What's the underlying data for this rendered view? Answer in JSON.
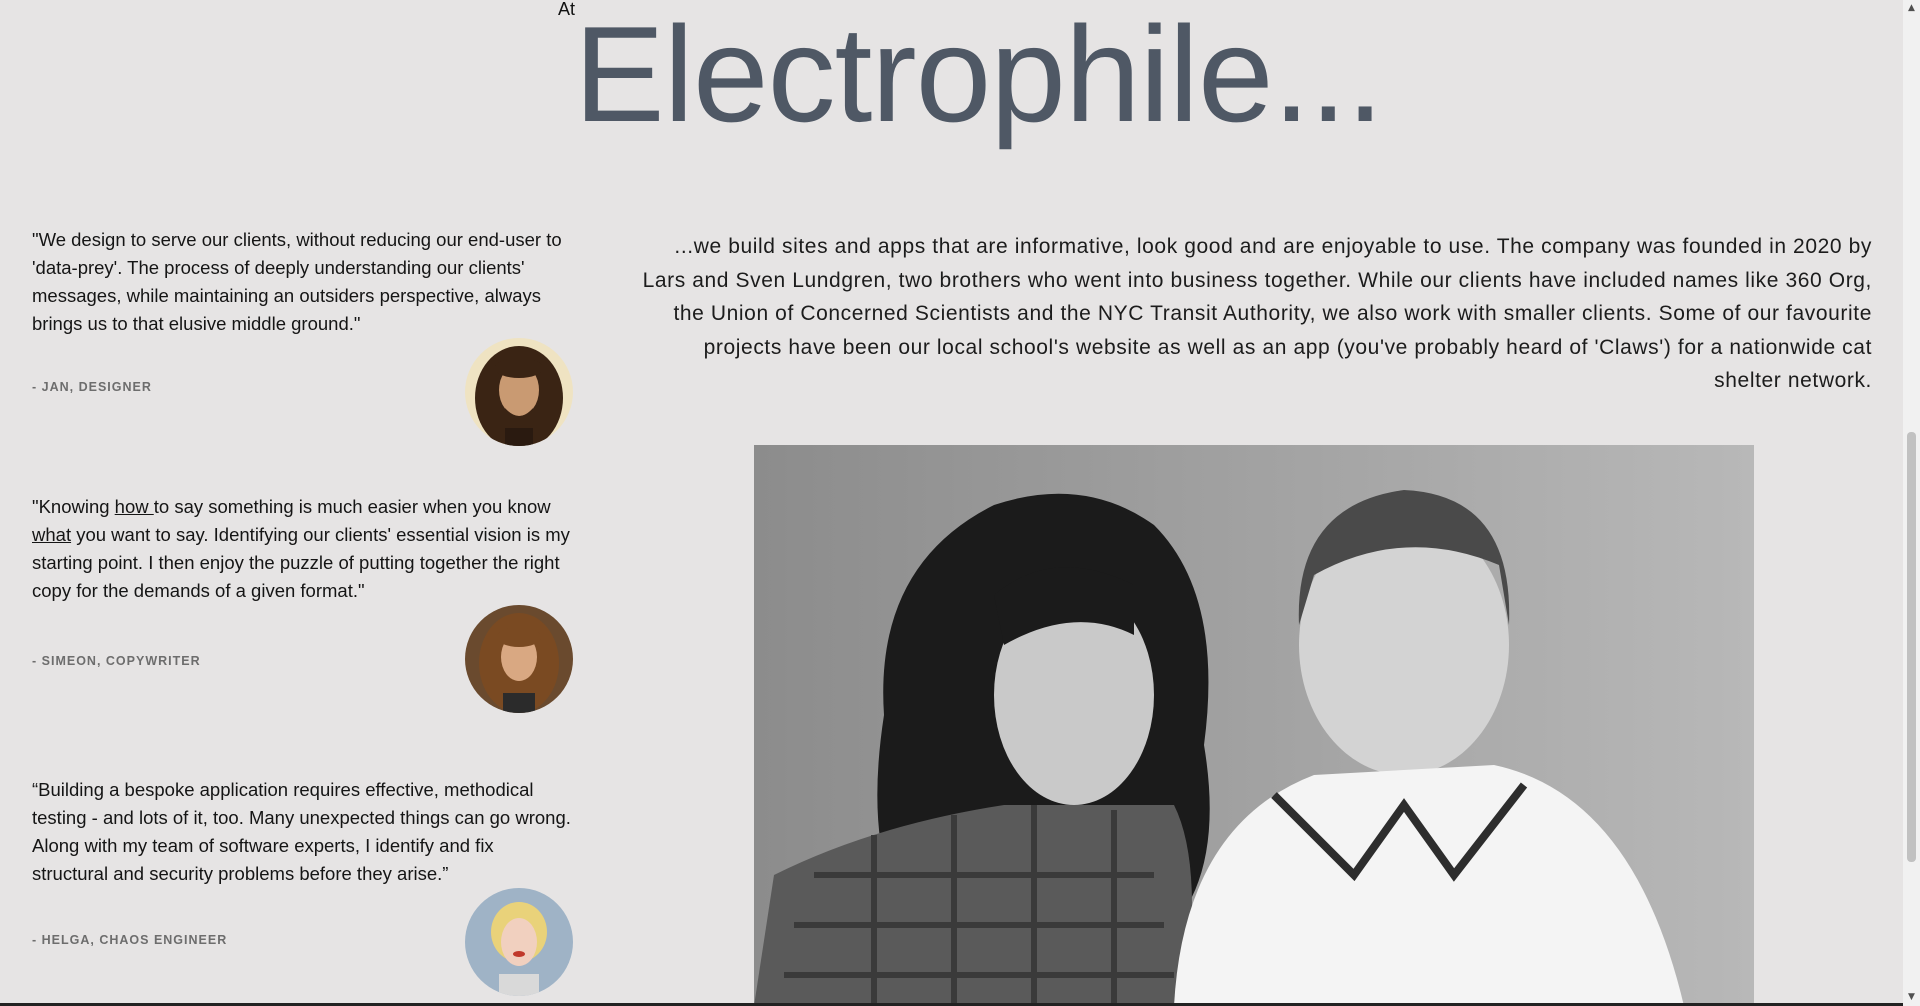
{
  "header": {
    "at_label": "At",
    "title": "Electrophile..."
  },
  "testimonials": [
    {
      "quote": "\"We design to serve our clients, without reducing our end-user to 'data-prey'. The process of deeply understanding our clients' messages, while maintaining an outsiders perspective, always brings us to that elusive middle ground.\"",
      "attribution": "- JAN, DESIGNER"
    },
    {
      "quote_part1": "\"Knowing ",
      "quote_how": "how ",
      "quote_part2": "to say something is much easier when you know ",
      "quote_what": "what",
      "quote_part3": " you want to say. Identifying our clients' essential vision is my starting point. I then enjoy the puzzle of putting together the right copy for the demands of a given format.\"",
      "attribution": "- SIMEON, COPYWRITER"
    },
    {
      "quote": "“Building a bespoke application requires effective, methodical testing - and lots of it, too. Many unexpected things can go wrong. Along with my team of software experts, I identify and fix structural and security problems before they arise.”",
      "attribution": "- HELGA, CHAOS ENGINEER"
    }
  ],
  "intro": {
    "text": "...we build sites and apps that are informative, look good and are enjoyable to use. The company was founded in 2020 by Lars and Sven Lundgren, two brothers who went into business together. While our clients have included names like 360 Org, the Union of Concerned Scientists and the NYC Transit Authority, we also work with smaller clients. Some of our favourite projects have been our local school's website as well as an app (you've probably heard of 'Claws') for a nationwide cat shelter network."
  },
  "scrollbar": {
    "up_icon": "▲",
    "down_icon": "▼"
  }
}
